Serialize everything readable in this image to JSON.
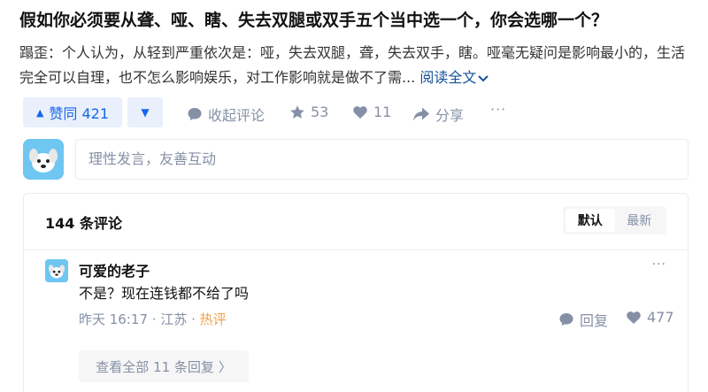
{
  "question": {
    "title": "假如你必须要从聋、哑、瞎、失去双腿或双手五个当中选一个，你会选哪一个？"
  },
  "answer": {
    "author": "蹋歪：",
    "excerpt": "个人认为，从轻到严重依次是：哑，失去双腿，聋，失去双手，瞎。哑毫无疑问是影响最小的，生活完全可以自理，也不怎么影响娱乐，对工作影响就是做不了需...",
    "read_more": "阅读全文"
  },
  "actions": {
    "upvote_label": "赞同 421",
    "collapse_label": "收起评论",
    "favorites_count": "53",
    "likes_count": "11",
    "share_label": "分享",
    "more_label": "···"
  },
  "comment_input": {
    "placeholder": "理性发言，友善互动"
  },
  "comments": {
    "count_label": "144 条评论",
    "sort_default": "默认",
    "sort_latest": "最新",
    "items": [
      {
        "user": "可爱的老子",
        "text": "不是？现在连钱都不给了吗",
        "time": "昨天 16:17",
        "location": "江苏",
        "badge": "热评",
        "reply_label": "回复",
        "likes": "477",
        "more": "···"
      }
    ],
    "view_all_label": "查看全部 11 条回复 〉"
  },
  "colors": {
    "accent": "#1766ec",
    "accent_bg": "#e9f0fc",
    "muted": "#8590a6",
    "hot": "#f1a34a",
    "avatar": "#6ec6f1"
  }
}
